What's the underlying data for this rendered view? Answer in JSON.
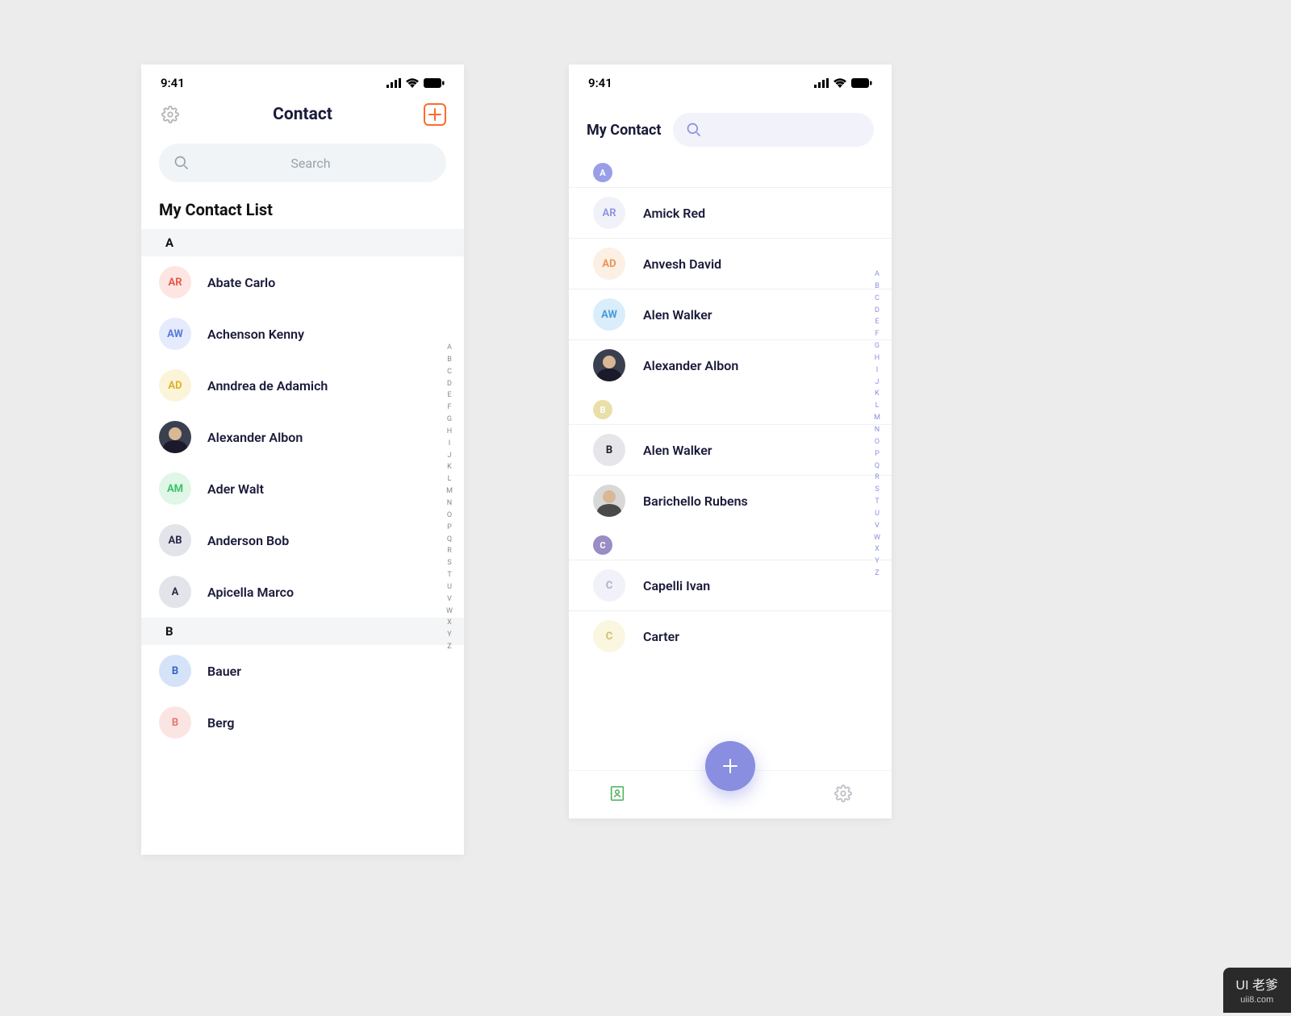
{
  "status": {
    "time": "9:41"
  },
  "phoneA": {
    "title": "Contact",
    "search_placeholder": "Search",
    "section_title": "My Contact List",
    "groups": [
      {
        "letter": "A",
        "contacts": [
          {
            "initials": "AR",
            "name": "Abate Carlo",
            "bg": "#fde5e2",
            "fg": "#e55a4a"
          },
          {
            "initials": "AW",
            "name": "Achenson Kenny",
            "bg": "#e5ebfc",
            "fg": "#5a7ad9"
          },
          {
            "initials": "AD",
            "name": "Anndrea de Adamich",
            "bg": "#fcf4d9",
            "fg": "#e0b028"
          },
          {
            "photo": true,
            "name": "Alexander Albon"
          },
          {
            "initials": "AM",
            "name": "Ader Walt",
            "bg": "#e0f6e6",
            "fg": "#3ec26a"
          },
          {
            "initials": "AB",
            "name": "Anderson Bob",
            "bg": "#e3e3ea",
            "fg": "#2a2a4a"
          },
          {
            "initials": "A",
            "name": "Apicella Marco",
            "bg": "#e3e3ea",
            "fg": "#2a2a4a"
          }
        ]
      },
      {
        "letter": "B",
        "contacts": [
          {
            "initials": "B",
            "name": "Bauer",
            "bg": "#d5e3f8",
            "fg": "#3565c4"
          },
          {
            "initials": "B",
            "name": "Berg",
            "bg": "#fbe5e3",
            "fg": "#e07a72"
          }
        ]
      }
    ]
  },
  "phoneB": {
    "title": "My Contact",
    "groups": [
      {
        "letter": "A",
        "chip_bg": "#9a9ee8",
        "contacts": [
          {
            "initials": "AR",
            "name": "Amick Red",
            "bg": "#f1f1fa",
            "fg": "#9195e0"
          },
          {
            "initials": "AD",
            "name": "Anvesh David",
            "bg": "#fcefe4",
            "fg": "#e8955a"
          },
          {
            "initials": "AW",
            "name": "Alen Walker",
            "bg": "#d9edfa",
            "fg": "#4a9cd8"
          },
          {
            "photo": true,
            "name": "Alexander Albon"
          }
        ]
      },
      {
        "letter": "B",
        "chip_bg": "#e9dfa8",
        "contacts": [
          {
            "initials": "B",
            "name": "Alen Walker",
            "bg": "#e6e6ea",
            "fg": "#222"
          },
          {
            "photo2": true,
            "name": "Barichello Rubens"
          }
        ]
      },
      {
        "letter": "C",
        "chip_bg": "#9a8cc4",
        "contacts": [
          {
            "initials": "C",
            "name": "Capelli Ivan",
            "bg": "#f1f1fa",
            "fg": "#b0b0c8"
          },
          {
            "initials": "C",
            "name": "Carter",
            "bg": "#faf6e0",
            "fg": "#d4c060"
          }
        ]
      }
    ]
  },
  "alpha": [
    "A",
    "B",
    "C",
    "D",
    "E",
    "F",
    "G",
    "H",
    "I",
    "J",
    "K",
    "L",
    "M",
    "N",
    "O",
    "P",
    "Q",
    "R",
    "S",
    "T",
    "U",
    "V",
    "W",
    "X",
    "Y",
    "Z"
  ],
  "watermark": {
    "main": "UI 老爹",
    "sub": "uii8.com"
  }
}
